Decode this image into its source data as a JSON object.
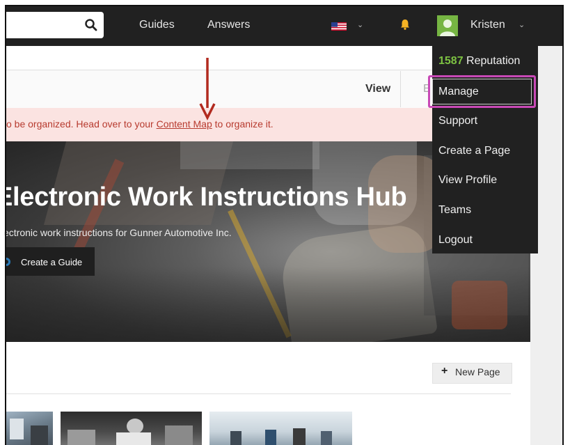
{
  "nav": {
    "search_placeholder": "",
    "guides_label": "Guides",
    "answers_label": "Answers",
    "user_name": "Kristen"
  },
  "toolbar": {
    "view_label": "View",
    "next_label": "E"
  },
  "alert": {
    "text_before": "o be organized. Head over to your ",
    "link_text": "Content Map",
    "text_after": " to organize it."
  },
  "hero": {
    "title": "Electronic Work Instructions Hub",
    "subtitle": "ectronic work instructions for Gunner Automotive Inc.",
    "create_label": "Create a Guide"
  },
  "content": {
    "new_page_label": "New Page"
  },
  "dropdown": {
    "reputation_value": "1587",
    "reputation_label": "Reputation",
    "items": [
      "Manage",
      "Support",
      "Create a Page",
      "View Profile",
      "Teams",
      "Logout"
    ]
  },
  "colors": {
    "nav_bg": "#212121",
    "alert_bg": "#fbe3e1",
    "alert_text": "#b73a2e",
    "reputation_green": "#7dc242",
    "highlight_pink": "#c849b6",
    "arrow_red": "#b22a1f"
  },
  "icons": {
    "search": "search-icon",
    "flag": "us-flag-icon",
    "bell": "bell-icon",
    "avatar": "avatar-icon",
    "plus": "plus-icon"
  }
}
